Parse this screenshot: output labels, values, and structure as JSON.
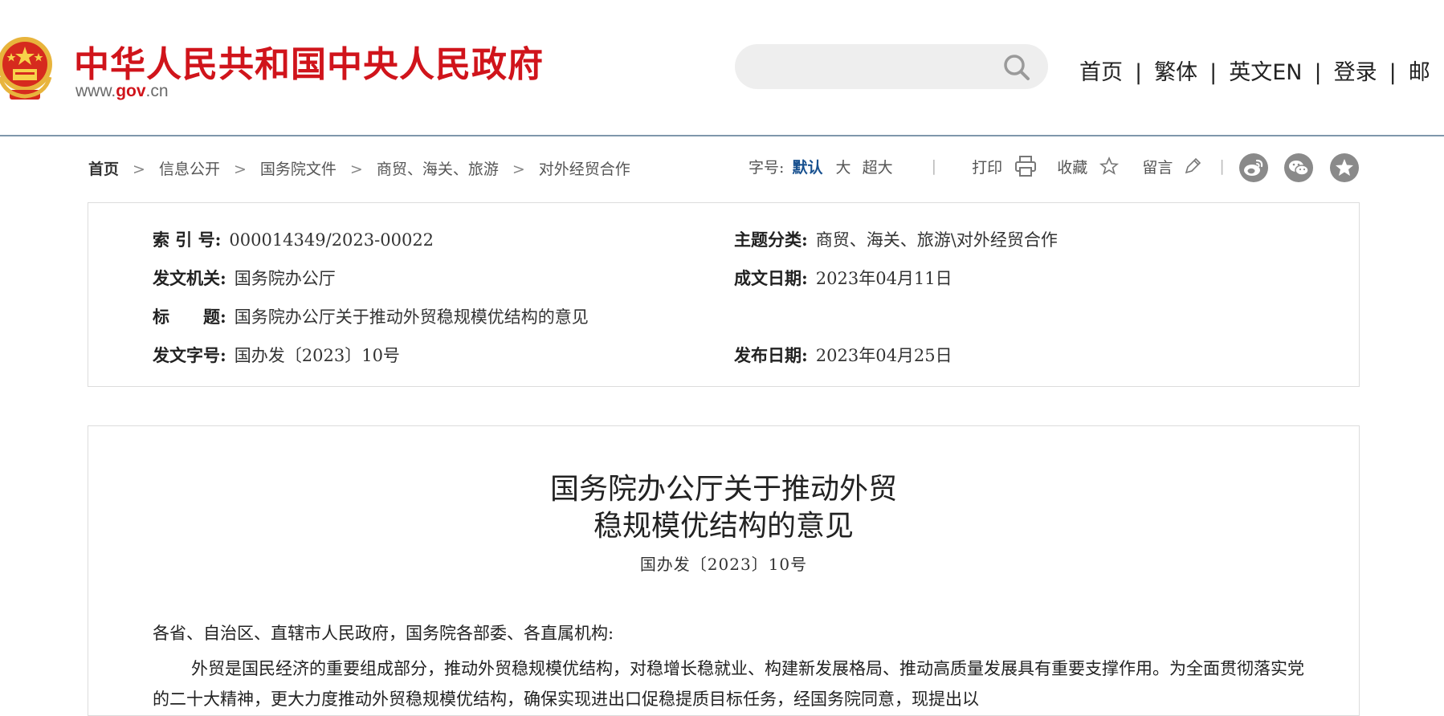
{
  "header": {
    "site_title": "中华人民共和国中央人民政府",
    "site_url_pre": "www.",
    "site_url_gov": "gov",
    "site_url_post": ".cn",
    "search_value": "",
    "nav": [
      "首页",
      "繁体",
      "英文EN",
      "登录",
      "邮"
    ]
  },
  "breadcrumb": [
    "首页",
    "信息公开",
    "国务院文件",
    "商贸、海关、旅游",
    "对外经贸合作"
  ],
  "tools": {
    "font_label": "字号:",
    "font_default": "默认",
    "font_large": "大",
    "font_xlarge": "超大",
    "print": "打印",
    "favorite": "收藏",
    "comment": "留言"
  },
  "info": {
    "index_label": "索 引 号:",
    "index_value": "000014349/2023-00022",
    "topic_label": "主题分类:",
    "topic_value": "商贸、海关、旅游\\对外经贸合作",
    "issuer_label": "发文机关:",
    "issuer_value": "国务院办公厅",
    "written_label": "成文日期:",
    "written_value": "2023年04月11日",
    "title_label": "标　　题:",
    "title_value": "国务院办公厅关于推动外贸稳规模优结构的意见",
    "docno_label": "发文字号:",
    "docno_value": "国办发〔2023〕10号",
    "published_label": "发布日期:",
    "published_value": "2023年04月25日"
  },
  "article": {
    "title_line1": "国务院办公厅关于推动外贸",
    "title_line2": "稳规模优结构的意见",
    "doc_number": "国办发〔2023〕10号",
    "salutation": "各省、自治区、直辖市人民政府，国务院各部委、各直属机构:",
    "paragraph1": "外贸是国民经济的重要组成部分，推动外贸稳规模优结构，对稳增长稳就业、构建新发展格局、推动高质量发展具有重要支撑作用。为全面贯彻落实党的二十大精神，更大力度推动外贸稳规模优结构，确保实现进出口促稳提质目标任务，经国务院同意，现提出以"
  },
  "colors": {
    "brand_red": "#d0141b",
    "link_blue": "#17508f",
    "header_rule": "#7f97ab"
  }
}
